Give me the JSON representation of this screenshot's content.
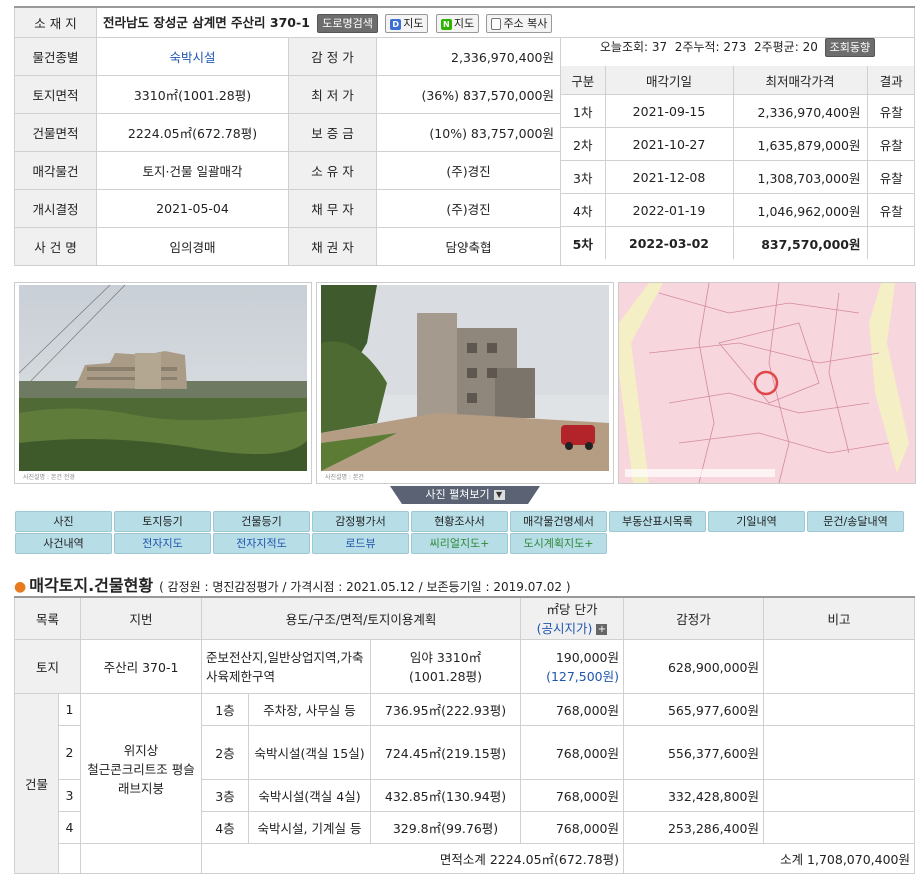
{
  "address": {
    "label": "소 재 지",
    "value": "전라남도 장성군 삼계면 주산리 370-1",
    "btn_road": "도로명검색",
    "btn_map1": "지도",
    "btn_map2": "지도",
    "btn_copy": "주소 복사"
  },
  "info": {
    "rows": [
      {
        "l1": "물건종별",
        "v1": "숙박시설",
        "l2": "감 정 가",
        "v2": "2,336,970,400원"
      },
      {
        "l1": "토지면적",
        "v1": "3310㎡(1001.28평)",
        "l2": "최 저 가",
        "v2": "(36%) 837,570,000원"
      },
      {
        "l1": "건물면적",
        "v1": "2224.05㎡(672.78평)",
        "l2": "보 증 금",
        "v2": "(10%) 83,757,000원"
      },
      {
        "l1": "매각물건",
        "v1": "토지·건물 일괄매각",
        "l2": "소 유 자",
        "v2": "(주)경진"
      },
      {
        "l1": "개시결정",
        "v1": "2021-05-04",
        "l2": "채 무 자",
        "v2": "(주)경진"
      },
      {
        "l1": "사 건 명",
        "v1": "임의경매",
        "l2": "채 권 자",
        "v2": "담양축협"
      }
    ]
  },
  "stats": {
    "text": "오늘조회: 37  2주누적: 273  2주평균: 20",
    "btn": "조회동향"
  },
  "schedule": {
    "headers": [
      "구분",
      "매각기일",
      "최저매각가격",
      "결과"
    ],
    "rows": [
      {
        "no": "1차",
        "date": "2021-09-15",
        "price": "2,336,970,400원",
        "result": "유찰"
      },
      {
        "no": "2차",
        "date": "2021-10-27",
        "price": "1,635,879,000원",
        "result": "유찰"
      },
      {
        "no": "3차",
        "date": "2021-12-08",
        "price": "1,308,703,000원",
        "result": "유찰"
      },
      {
        "no": "4차",
        "date": "2022-01-19",
        "price": "1,046,962,000원",
        "result": "유찰"
      },
      {
        "no": "5차",
        "date": "2022-03-02",
        "price": "837,570,000원",
        "result": ""
      }
    ]
  },
  "photos": {
    "toggle": "사진 펼쳐보기",
    "caption1": "사진설명 : 본건 전경",
    "caption2": "사진설명 : 본건"
  },
  "nav": {
    "row1": [
      "사진",
      "토지등기",
      "건물등기",
      "감정평가서",
      "현황조사서",
      "매각물건명세서",
      "부동산표시목록",
      "기일내역",
      "문건/송달내역"
    ],
    "row2": [
      "사건내역",
      "전자지도",
      "전자지적도",
      "로드뷰",
      "씨리얼지도+",
      "도시계획지도+"
    ]
  },
  "section": {
    "title": "매각토지.건물현황",
    "subtitle": "( 감정원 : 명진감정평가 / 가격시점 : 2021.05.12 / 보존등기일 : 2019.07.02 )"
  },
  "land": {
    "headers": {
      "list": "목록",
      "lot": "지번",
      "use": "용도/구조/면적/토지이용계획",
      "unit": "㎡당 단가",
      "unit_sub": "(공시지가)",
      "appraisal": "감정가",
      "note": "비고"
    },
    "land_row": {
      "type": "토지",
      "lot": "주산리 370-1",
      "zone": "준보전산지,일반상업지역,가축사육제한구역",
      "area1": "임야 3310㎡",
      "area2": "(1001.28평)",
      "unit": "190,000원",
      "public": "(127,500원)",
      "price": "628,900,000원"
    },
    "building_label": "건물",
    "structure": "위지상\n철근콘크리트조 평슬래브지붕",
    "floors": [
      {
        "no": "1",
        "floor": "1층",
        "use": "주차장, 사무실 등",
        "area": "736.95㎡(222.93평)",
        "unit": "768,000원",
        "price": "565,977,600원"
      },
      {
        "no": "2",
        "floor": "2층",
        "use": "숙박시설(객실 15실)",
        "area": "724.45㎡(219.15평)",
        "unit": "768,000원",
        "price": "556,377,600원"
      },
      {
        "no": "3",
        "floor": "3층",
        "use": "숙박시설(객실 4실)",
        "area": "432.85㎡(130.94평)",
        "unit": "768,000원",
        "price": "332,428,800원"
      },
      {
        "no": "4",
        "floor": "4층",
        "use": "숙박시설, 기계실 등",
        "area": "329.8㎡(99.76평)",
        "unit": "768,000원",
        "price": "253,286,400원"
      }
    ],
    "area_total": "면적소계 2224.05㎡(672.78평)",
    "price_total": "소계 1,708,070,400원"
  }
}
